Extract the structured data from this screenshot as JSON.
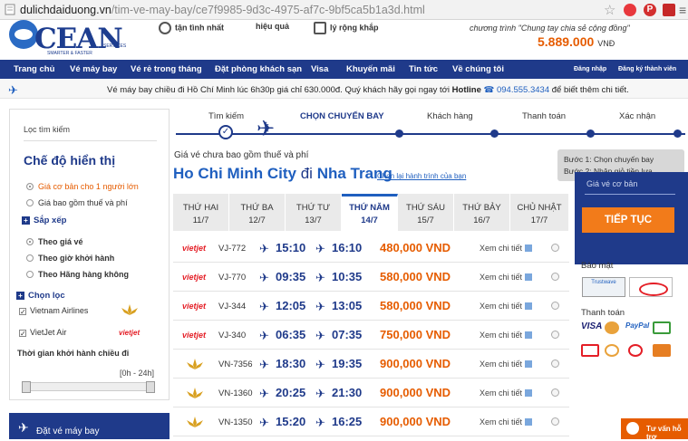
{
  "browser": {
    "url_domain": "dulichdaiduong.vn",
    "url_path": "/tim-ve-may-bay/ce7f9985-9d3c-4975-af7c-9bf5ca5b1a3d.html"
  },
  "header": {
    "logo_text": "CEAN",
    "logo_tagline": "SMARTER & FASTER",
    "logo_services": "SERVICES",
    "features": [
      "tận tình nhất",
      "hiệu quả",
      "lý rộng khắp"
    ],
    "program_text": "chương trình \"Chung tay chia sẻ cộng đồng\"",
    "program_amount": "5.889.000",
    "program_currency": "VNĐ"
  },
  "nav": {
    "items": [
      "Trang chủ",
      "Vé máy bay",
      "Vé rẻ trong tháng",
      "Đặt phòng khách sạn",
      "Visa",
      "Khuyến mãi",
      "Tin tức",
      "Về chúng tôi"
    ],
    "login": "Đăng nhập",
    "register": "Đăng ký thành viên"
  },
  "notice": {
    "text": "Vé máy bay chiều đi Hồ Chí Minh lúc 6h30p giá chỉ 630.000đ. Quý khách hãy gọi ngay tới",
    "hotline_label": "Hotline",
    "phone": "094.555.3434",
    "suffix": "để biết thêm chi tiết."
  },
  "sidebar": {
    "filter_title": "Lọc tìm kiếm",
    "display_heading": "Chế độ hiển thị",
    "display_options": [
      "Giá cơ bản cho 1 người lớn",
      "Giá bao gồm thuế và phí"
    ],
    "sort_heading": "Sắp xếp",
    "sort_options": [
      "Theo giá vé",
      "Theo giờ khởi hành",
      "Theo Hãng hàng không"
    ],
    "filter_heading": "Chọn lọc",
    "airlines": [
      "Vietnam Airlines",
      "VietJet Air"
    ],
    "vietjet_logo": "vietjet",
    "time_heading": "Thời gian khởi hành chiều đi",
    "time_range": "[0h - 24h]",
    "bottom_label": "Đặt vé máy bay"
  },
  "steps": {
    "items": [
      "Tìm kiếm",
      "CHỌN CHUYẾN BAY",
      "Khách hàng",
      "Thanh toán",
      "Xác nhận"
    ]
  },
  "route": {
    "fee_note": "Giá vé chưa bao gồm thuế và phí",
    "from": "Ho Chi Minh City",
    "connector": "đi",
    "to": "Nha Trang",
    "change_link": "Chọn lại hành trình của bạn"
  },
  "days": [
    {
      "name": "THỨ HAI",
      "date": "11/7"
    },
    {
      "name": "THỨ BA",
      "date": "12/7"
    },
    {
      "name": "THỨ TƯ",
      "date": "13/7"
    },
    {
      "name": "THỨ NĂM",
      "date": "14/7"
    },
    {
      "name": "THỨ SÁU",
      "date": "15/7"
    },
    {
      "name": "THỨ BẢY",
      "date": "16/7"
    },
    {
      "name": "CHỦ NHẬT",
      "date": "17/7"
    }
  ],
  "flights": [
    {
      "airline": "vietjet",
      "logo": "vietjet",
      "code": "VJ-772",
      "dep": "15:10",
      "arr": "16:10",
      "price": "480,000 VND",
      "detail": "Xem chi tiết"
    },
    {
      "airline": "vietjet",
      "logo": "vietjet",
      "code": "VJ-770",
      "dep": "09:35",
      "arr": "10:35",
      "price": "580,000 VND",
      "detail": "Xem chi tiết"
    },
    {
      "airline": "vietjet",
      "logo": "vietjet",
      "code": "VJ-344",
      "dep": "12:05",
      "arr": "13:05",
      "price": "580,000 VND",
      "detail": "Xem chi tiết"
    },
    {
      "airline": "vietjet",
      "logo": "vietjet",
      "code": "VJ-340",
      "dep": "06:35",
      "arr": "07:35",
      "price": "750,000 VND",
      "detail": "Xem chi tiết"
    },
    {
      "airline": "vietnam",
      "logo": "",
      "code": "VN-7356",
      "dep": "18:30",
      "arr": "19:35",
      "price": "900,000 VND",
      "detail": "Xem chi tiết"
    },
    {
      "airline": "vietnam",
      "logo": "",
      "code": "VN-1360",
      "dep": "20:25",
      "arr": "21:30",
      "price": "900,000 VND",
      "detail": "Xem chi tiết"
    },
    {
      "airline": "vietnam",
      "logo": "",
      "code": "VN-1350",
      "dep": "15:20",
      "arr": "16:25",
      "price": "900,000 VND",
      "detail": "Xem chi tiết"
    }
  ],
  "right": {
    "step1": "Bước 1: Chọn chuyến bay",
    "step2": "Bước 2: Nhập giỏ tiền lựa",
    "base_price_label": "Giá vé cơ bản",
    "continue_button": "TIẾP TỤC",
    "security_title": "Bảo mật",
    "trustwave_text": "Trustwave",
    "payment_title": "Thanh toán",
    "visa_text": "VISA",
    "paypal_text": "PayPal",
    "chat_label": "Tư vấn hỗ trợ"
  },
  "colors": {
    "navy": "#1f3a8a",
    "orange": "#e65c00",
    "link": "#1f5fbf"
  }
}
